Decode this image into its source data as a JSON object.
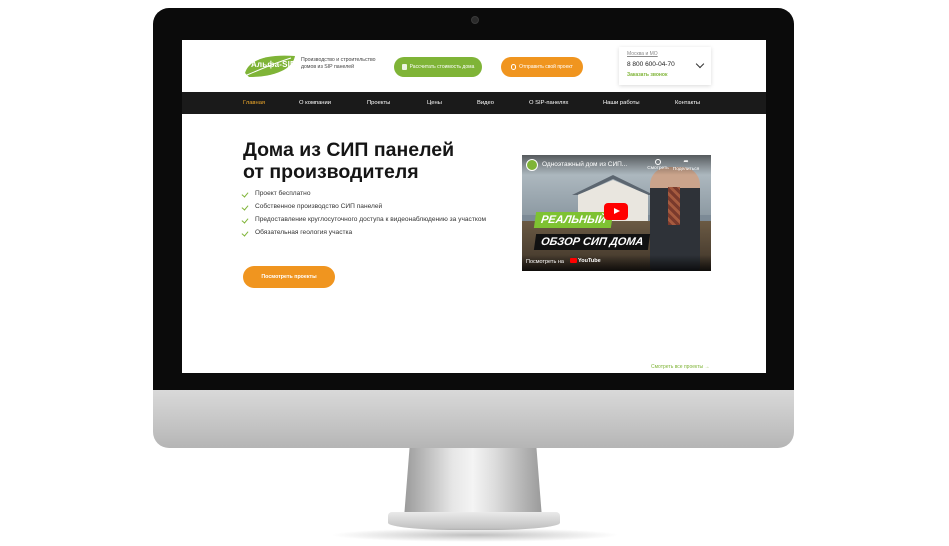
{
  "header": {
    "logo_text": "Альфа-SIP",
    "tagline": [
      "Производство и строительство",
      "домов из SIP панелей"
    ],
    "calc_button": "Рассчитать стоимость дома",
    "send_button": "Отправить свой проект",
    "city": "Москва и МО",
    "phone": "8 800 600-04-70",
    "callback": "Заказать звонок"
  },
  "nav": {
    "items": [
      {
        "label": "Главная",
        "active": true
      },
      {
        "label": "О компании"
      },
      {
        "label": "Проекты"
      },
      {
        "label": "Цены"
      },
      {
        "label": "Видео"
      },
      {
        "label": "О SIP-панелях"
      },
      {
        "label": "Наши работы"
      },
      {
        "label": "Контакты"
      }
    ]
  },
  "hero": {
    "title_line1": "Дома из СИП панелей",
    "title_line2": "от производителя",
    "features": [
      "Проект бесплатно",
      "Собственное производство СИП панелей",
      "Предоставление круглосуточного доступа к видеонаблюдению за участком",
      "Обязательная геология участка"
    ],
    "cta": "Посмотреть проекты"
  },
  "video": {
    "title": "Одноэтажный дом из СИП...",
    "watch_later": "Смотреть",
    "share": "Поделиться",
    "overlay_line1": "РЕАЛЬНЫЙ",
    "overlay_line2": "ОБЗОР СИП ДОМА",
    "watch_on": "Посмотреть на",
    "youtube": "YouTube"
  },
  "footer_link": "Смотреть все проекты →",
  "colors": {
    "accent_green": "#7fb437",
    "accent_orange": "#f0951f",
    "nav_bg": "#1a1a1a",
    "nav_active": "#f0a92a"
  },
  "icons": [
    "calculator-icon",
    "paperclip-icon",
    "chevron-down-icon",
    "check-icon",
    "play-icon"
  ]
}
